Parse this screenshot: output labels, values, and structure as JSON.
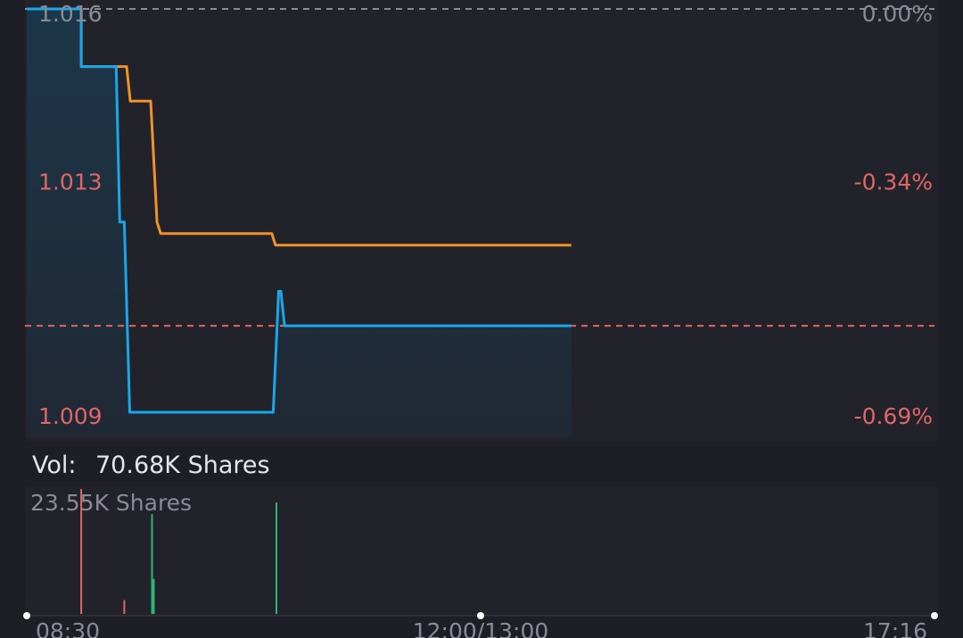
{
  "theme": {
    "page_bg": "#1e1e26",
    "panel_bg": "#22222b",
    "price_line": "#1ba6e8",
    "avg_line": "#f0922a",
    "negative": "#e06666",
    "positive": "#2bb673",
    "muted": "#8a8b96",
    "text": "#e6e6ea",
    "grid": "#8a8b96",
    "ref_line": "#e06666",
    "area_fill": "#1b3a4f"
  },
  "price_axis": {
    "left_ticks": [
      "1.016",
      "1.013",
      "1.009"
    ],
    "right_ticks": [
      "0.00%",
      "-0.34%",
      "-0.69%"
    ]
  },
  "volume_header": {
    "label": "Vol:",
    "value": "70.68K Shares"
  },
  "volume_axis": {
    "max_label": "23.55K Shares"
  },
  "time_axis": {
    "ticks": [
      "08:30",
      "12:00/13:00",
      "17:16"
    ]
  },
  "chart_data": [
    {
      "type": "line",
      "title": "",
      "x_unit": "session index (0 = 08:30, 1 = 12:00/13:00, 2 = 17:16)",
      "ylim": [
        1.009,
        1.016
      ],
      "reference_price": 1.0105,
      "series": [
        {
          "name": "",
          "role": "price",
          "color": "#1ba6e8",
          "points": [
            [
              0.0,
              1.016
            ],
            [
              0.12,
              1.016
            ],
            [
              0.12,
              1.015
            ],
            [
              0.197,
              1.015
            ],
            [
              0.205,
              1.0123
            ],
            [
              0.215,
              1.0123
            ],
            [
              0.227,
              1.009
            ],
            [
              0.543,
              1.009
            ],
            [
              0.555,
              1.0111
            ],
            [
              0.56,
              1.0111
            ],
            [
              0.568,
              1.0105
            ],
            [
              1.2,
              1.0105
            ]
          ]
        },
        {
          "name": "",
          "role": "average",
          "color": "#f0922a",
          "points": [
            [
              0.0,
              1.016
            ],
            [
              0.12,
              1.016
            ],
            [
              0.12,
              1.015
            ],
            [
              0.22,
              1.015
            ],
            [
              0.228,
              1.0144
            ],
            [
              0.273,
              1.0144
            ],
            [
              0.287,
              1.0123
            ],
            [
              0.295,
              1.0121
            ],
            [
              0.54,
              1.0121
            ],
            [
              0.548,
              1.0119
            ],
            [
              1.2,
              1.0119
            ]
          ]
        }
      ]
    },
    {
      "type": "bar",
      "title": "",
      "ylim": [
        0,
        23.55
      ],
      "y_unit": "K Shares",
      "bars": [
        {
          "x": 0.12,
          "value": 23.55,
          "direction": "down"
        },
        {
          "x": 0.215,
          "value": 2.6,
          "direction": "down"
        },
        {
          "x": 0.276,
          "value": 18.8,
          "direction": "up"
        },
        {
          "x": 0.28,
          "value": 6.6,
          "direction": "up"
        },
        {
          "x": 0.55,
          "value": 21.0,
          "direction": "up"
        }
      ]
    }
  ]
}
